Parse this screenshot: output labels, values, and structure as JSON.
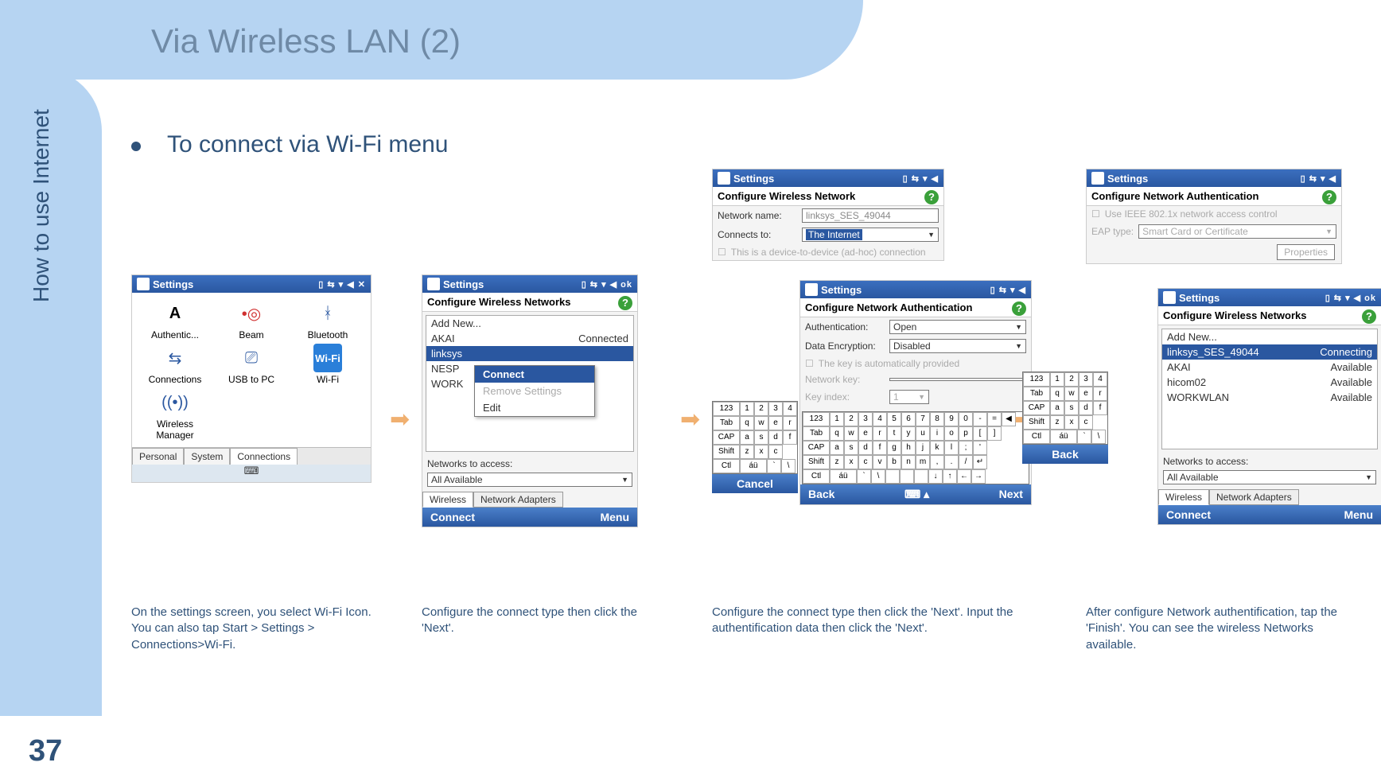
{
  "page": {
    "title": "Via Wireless LAN (2)",
    "side_label": "How to use Internet",
    "page_number": "37",
    "heading": "To connect via Wi-Fi menu"
  },
  "shot1": {
    "title": "Settings",
    "icons": [
      {
        "label": "Authentic...",
        "glyph": "A"
      },
      {
        "label": "Beam",
        "glyph": "•◎"
      },
      {
        "label": "Bluetooth",
        "glyph": "ᚼ"
      },
      {
        "label": "Connections",
        "glyph": "⇆"
      },
      {
        "label": "USB to PC",
        "glyph": "⎚"
      },
      {
        "label": "Wi-Fi",
        "glyph": "Wi-Fi"
      },
      {
        "label": "Wireless Manager",
        "glyph": "((•))"
      }
    ],
    "tabs": [
      "Personal",
      "System",
      "Connections"
    ]
  },
  "shot2": {
    "title": "Settings",
    "section": "Configure Wireless Networks",
    "addnew": "Add New...",
    "rows": [
      {
        "name": "AKAI",
        "status": "Connected"
      },
      {
        "name": "linksys",
        "status": ""
      },
      {
        "name": "NESP",
        "status": ""
      },
      {
        "name": "WORK",
        "status": ""
      }
    ],
    "ctx": {
      "title": "Connect",
      "remove": "Remove Settings",
      "edit": "Edit"
    },
    "net_label": "Networks to access:",
    "net_value": "All Available",
    "bottom_tabs": [
      "Wireless",
      "Network Adapters"
    ],
    "bot_left": "Connect",
    "bot_right": "Menu"
  },
  "shot3a": {
    "title": "Settings",
    "section": "Configure Wireless Network",
    "netname_l": "Network name:",
    "netname_v": "linksys_SES_49044",
    "conn_l": "Connects to:",
    "conn_v": "The Internet",
    "hidden": "This is a device-to-device (ad-hoc) connection"
  },
  "shot3b": {
    "title": "Settings",
    "section": "Configure Network Authentication",
    "auth_l": "Authentication:",
    "auth_v": "Open",
    "enc_l": "Data Encryption:",
    "enc_v": "Disabled",
    "auto": "The key is automatically provided",
    "key_l": "Network key:",
    "idx_l": "Key index:",
    "idx_v": "1",
    "bot_left": "Back",
    "bot_right": "Next"
  },
  "kbd_small": {
    "cancel": "Cancel",
    "rows": [
      [
        "123",
        "1",
        "2",
        "3",
        "4"
      ],
      [
        "Tab",
        "q",
        "w",
        "e",
        "r"
      ],
      [
        "CAP",
        "a",
        "s",
        "d",
        "f"
      ],
      [
        "Shift",
        "z",
        "x",
        "c"
      ],
      [
        "Ctl",
        "áü",
        "`",
        "\\"
      ]
    ]
  },
  "kbd_full": {
    "rows": [
      [
        "123",
        "1",
        "2",
        "3",
        "4",
        "5",
        "6",
        "7",
        "8",
        "9",
        "0",
        "-",
        "=",
        "◀"
      ],
      [
        "Tab",
        "q",
        "w",
        "e",
        "r",
        "t",
        "y",
        "u",
        "i",
        "o",
        "p",
        "[",
        "]"
      ],
      [
        "CAP",
        "a",
        "s",
        "d",
        "f",
        "g",
        "h",
        "j",
        "k",
        "l",
        ";",
        "'"
      ],
      [
        "Shift",
        "z",
        "x",
        "c",
        "v",
        "b",
        "n",
        "m",
        ",",
        ".",
        "/",
        "↵"
      ],
      [
        "Ctl",
        "áü",
        "`",
        "\\",
        "",
        "",
        "",
        "↓",
        "↑",
        "←",
        "→"
      ]
    ]
  },
  "shot4a": {
    "title": "Settings",
    "section": "Configure Network Authentication",
    "chk": "Use IEEE 802.1x network access control",
    "eap_l": "EAP type:",
    "eap_v": "Smart Card or Certificate",
    "prop": "Properties"
  },
  "shot4b": {
    "title": "Settings",
    "section": "Configure Wireless Networks",
    "addnew": "Add New...",
    "rows": [
      {
        "name": "linksys_SES_49044",
        "status": "Connecting"
      },
      {
        "name": "AKAI",
        "status": "Available"
      },
      {
        "name": "hicom02",
        "status": "Available"
      },
      {
        "name": "WORKWLAN",
        "status": "Available"
      }
    ],
    "net_label": "Networks to access:",
    "net_value": "All Available",
    "bottom_tabs": [
      "Wireless",
      "Network Adapters"
    ],
    "bot_left": "Connect",
    "bot_right": "Menu",
    "back": "Back"
  },
  "captions": {
    "c1": "On the settings screen, you select Wi-Fi Icon.\nYou can also tap Start > Settings > Connections>Wi-Fi.",
    "c2": "Configure the connect type then click the 'Next'.",
    "c3": "Configure the connect type then click the 'Next'. Input the authentification data then click the 'Next'.",
    "c4": "After configure Network authentification, tap the 'Finish'. You can see the wireless Networks available."
  }
}
